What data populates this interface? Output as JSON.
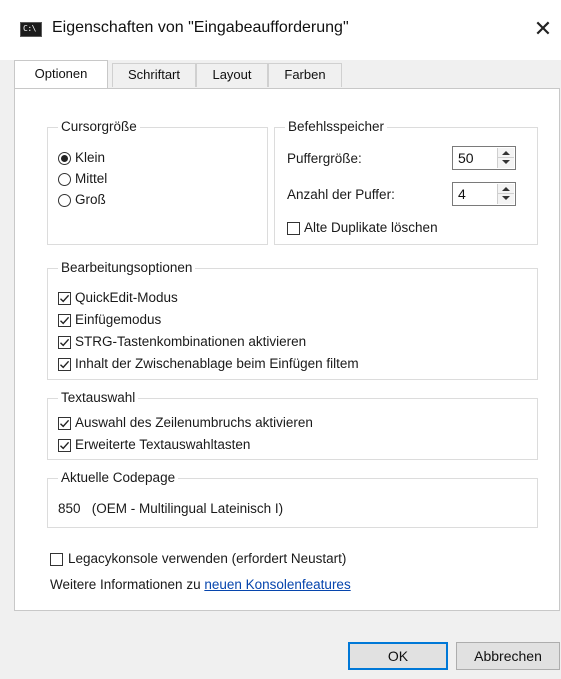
{
  "window": {
    "title": "Eigenschaften von \"Eingabeaufforderung\"",
    "icon": "console-icon",
    "icon_glyph": "C:\\",
    "close_glyph": "✕"
  },
  "tabs": [
    {
      "label": "Optionen",
      "active": true
    },
    {
      "label": "Schriftart",
      "active": false
    },
    {
      "label": "Layout",
      "active": false
    },
    {
      "label": "Farben",
      "active": false
    }
  ],
  "cursor_size": {
    "title": "Cursorgröße",
    "options": [
      {
        "label": "Klein",
        "selected": true
      },
      {
        "label": "Mittel",
        "selected": false
      },
      {
        "label": "Groß",
        "selected": false
      }
    ]
  },
  "command_history": {
    "title": "Befehlsspeicher",
    "buffer_size_label": "Puffergröße:",
    "buffer_size_value": "50",
    "buffer_count_label": "Anzahl der Puffer:",
    "buffer_count_value": "4",
    "discard_duplicates_label": "Alte Duplikate löschen",
    "discard_duplicates_checked": false
  },
  "edit_options": {
    "title": "Bearbeitungsoptionen",
    "items": [
      {
        "label": "QuickEdit-Modus",
        "checked": true
      },
      {
        "label": "Einfügemodus",
        "checked": true
      },
      {
        "label": "STRG-Tastenkombinationen aktivieren",
        "checked": true
      },
      {
        "label": "Inhalt der Zwischenablage beim Einfügen filtem",
        "checked": true
      }
    ]
  },
  "text_selection": {
    "title": "Textauswahl",
    "items": [
      {
        "label": "Auswahl des Zeilenumbruchs aktivieren",
        "checked": true
      },
      {
        "label": "Erweiterte Textauswahltasten",
        "checked": true
      }
    ]
  },
  "codepage": {
    "title": "Aktuelle Codepage",
    "value": "850   (OEM - Multilingual Lateinisch I)"
  },
  "legacy": {
    "label": "Legacykonsole verwenden (erfordert Neustart)",
    "checked": false
  },
  "more_info": {
    "prefix": "Weitere Informationen zu ",
    "link_text": "neuen Konsolenfeatures"
  },
  "buttons": {
    "ok": "OK",
    "cancel": "Abbrechen"
  },
  "colors": {
    "accent": "#0078d7",
    "link": "#0645ad"
  }
}
